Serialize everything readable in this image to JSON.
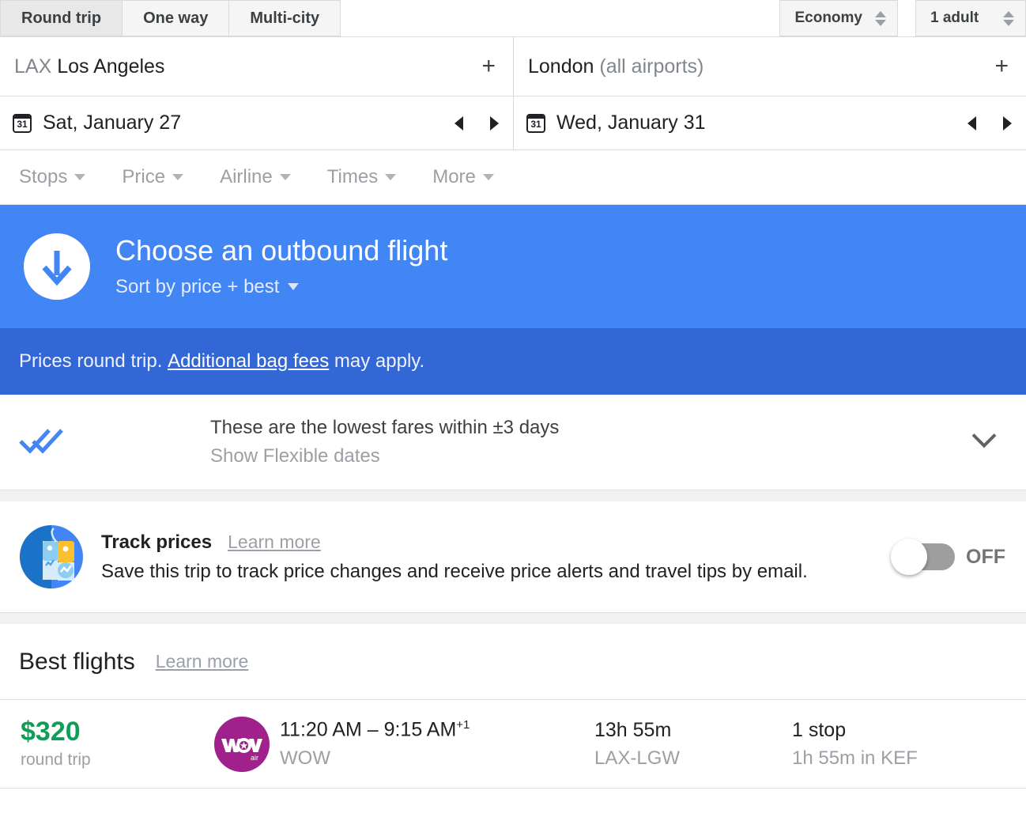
{
  "trip_types": [
    {
      "label": "Round trip",
      "active": true
    },
    {
      "label": "One way",
      "active": false
    },
    {
      "label": "Multi-city",
      "active": false
    }
  ],
  "cabin": {
    "label": "Economy"
  },
  "passengers": {
    "label": "1 adult"
  },
  "route": {
    "origin_code": "LAX",
    "origin_city": "Los Angeles",
    "destination_city": "London",
    "destination_note": "(all airports)",
    "add_icon": "+"
  },
  "dates": {
    "calendar_icon_label": "31",
    "depart": "Sat, January 27",
    "return": "Wed, January 31"
  },
  "filters": [
    {
      "label": "Stops"
    },
    {
      "label": "Price"
    },
    {
      "label": "Airline"
    },
    {
      "label": "Times"
    },
    {
      "label": "More"
    }
  ],
  "hero": {
    "title": "Choose an outbound flight",
    "sort_label": "Sort by price + best",
    "banner_color": "#4285f4"
  },
  "subbanner": {
    "prefix": "Prices round trip.",
    "link": "Additional bag fees",
    "suffix": "may apply.",
    "banner_color": "#3367d6"
  },
  "flexible": {
    "title": "These are the lowest fares within ±3 days",
    "subtitle": "Show Flexible dates"
  },
  "track_prices": {
    "title": "Track prices",
    "learn_more": "Learn more",
    "description": "Save this trip to track price changes and receive price alerts and travel tips by email.",
    "toggle_state": "OFF"
  },
  "best_flights": {
    "title": "Best flights",
    "learn_more": "Learn more"
  },
  "flights": [
    {
      "price": "$320",
      "price_sub": "round trip",
      "airline_logo": "wow-air-logo",
      "logo_color": "#a0208c",
      "times": "11:20 AM – 9:15 AM",
      "times_sup": "+1",
      "airline": "WOW",
      "duration": "13h 55m",
      "route": "LAX-LGW",
      "stops": "1 stop",
      "layover": "1h 55m in KEF"
    }
  ]
}
